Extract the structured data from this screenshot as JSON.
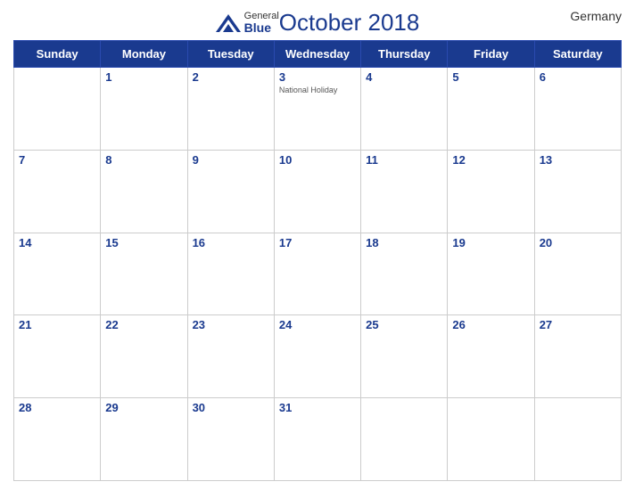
{
  "header": {
    "logo_general": "General",
    "logo_blue": "Blue",
    "month_title": "October 2018",
    "country": "Germany"
  },
  "days_of_week": [
    "Sunday",
    "Monday",
    "Tuesday",
    "Wednesday",
    "Thursday",
    "Friday",
    "Saturday"
  ],
  "weeks": [
    [
      {
        "day": "",
        "empty": true
      },
      {
        "day": "1"
      },
      {
        "day": "2"
      },
      {
        "day": "3",
        "holiday": "National Holiday"
      },
      {
        "day": "4"
      },
      {
        "day": "5"
      },
      {
        "day": "6"
      }
    ],
    [
      {
        "day": "7"
      },
      {
        "day": "8"
      },
      {
        "day": "9"
      },
      {
        "day": "10"
      },
      {
        "day": "11"
      },
      {
        "day": "12"
      },
      {
        "day": "13"
      }
    ],
    [
      {
        "day": "14"
      },
      {
        "day": "15"
      },
      {
        "day": "16"
      },
      {
        "day": "17"
      },
      {
        "day": "18"
      },
      {
        "day": "19"
      },
      {
        "day": "20"
      }
    ],
    [
      {
        "day": "21"
      },
      {
        "day": "22"
      },
      {
        "day": "23"
      },
      {
        "day": "24"
      },
      {
        "day": "25"
      },
      {
        "day": "26"
      },
      {
        "day": "27"
      }
    ],
    [
      {
        "day": "28"
      },
      {
        "day": "29"
      },
      {
        "day": "30"
      },
      {
        "day": "31"
      },
      {
        "day": "",
        "empty": true
      },
      {
        "day": "",
        "empty": true
      },
      {
        "day": "",
        "empty": true
      }
    ]
  ]
}
